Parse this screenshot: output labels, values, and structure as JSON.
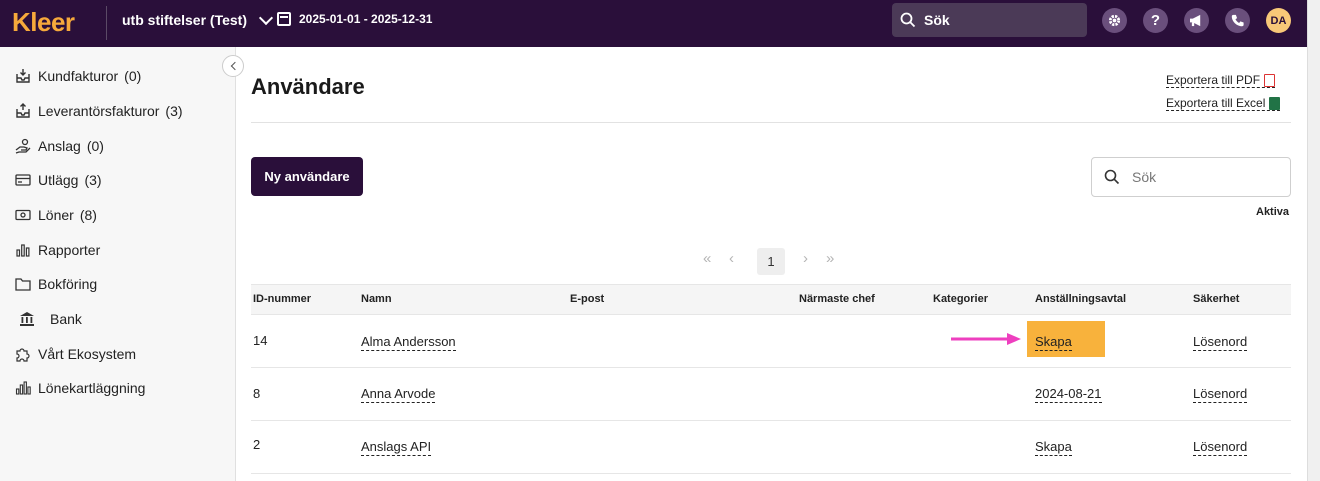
{
  "topbar": {
    "logo": "Kleer",
    "company": "utb stiftelser (Test)",
    "period": "2025-01-01 - 2025-12-31",
    "search_label": "Sök",
    "avatar_initials": "DA"
  },
  "sidebar": {
    "items": [
      {
        "label": "Kundfakturor",
        "count": "(0)",
        "icon": "inbox-in-icon"
      },
      {
        "label": "Leverantörsfakturor",
        "count": "(3)",
        "icon": "inbox-out-icon"
      },
      {
        "label": "Anslag",
        "count": "(0)",
        "icon": "hand-coin-icon"
      },
      {
        "label": "Utlägg",
        "count": "(3)",
        "icon": "card-icon"
      },
      {
        "label": "Löner",
        "count": "(8)",
        "icon": "money-icon"
      },
      {
        "label": "Rapporter",
        "count": "",
        "icon": "bar-chart-icon"
      },
      {
        "label": "Bokföring",
        "count": "",
        "icon": "folder-icon"
      },
      {
        "label": "Bank",
        "count": "",
        "icon": "bank-icon"
      },
      {
        "label": "Vårt Ekosystem",
        "count": "",
        "icon": "puzzle-icon"
      },
      {
        "label": "Lönekartläggning",
        "count": "",
        "icon": "chart-icon"
      }
    ]
  },
  "main": {
    "title": "Användare",
    "export_pdf": "Exportera till PDF",
    "export_excel": "Exportera till Excel",
    "new_user_button": "Ny användare",
    "search_placeholder": "Sök",
    "filter_label": "Aktiva",
    "current_page": "1",
    "columns": [
      "ID-nummer",
      "Namn",
      "E-post",
      "Närmaste chef",
      "Kategorier",
      "Anställningsavtal",
      "Säkerhet"
    ],
    "rows": [
      {
        "id": "14",
        "name": "Alma Andersson",
        "email": "",
        "manager": "",
        "categories": "",
        "contract": "Skapa",
        "security": "Lösenord"
      },
      {
        "id": "8",
        "name": "Anna Arvode",
        "email": "",
        "manager": "",
        "categories": "",
        "contract": "2024-08-21",
        "security": "Lösenord"
      },
      {
        "id": "2",
        "name": "Anslags API",
        "email": "",
        "manager": "",
        "categories": "",
        "contract": "Skapa",
        "security": "Lösenord"
      }
    ]
  },
  "colors": {
    "brand": "#2a0f3a",
    "accent": "#f6a93b",
    "highlight": "#f8b23c",
    "arrow": "#ee3fbf"
  }
}
